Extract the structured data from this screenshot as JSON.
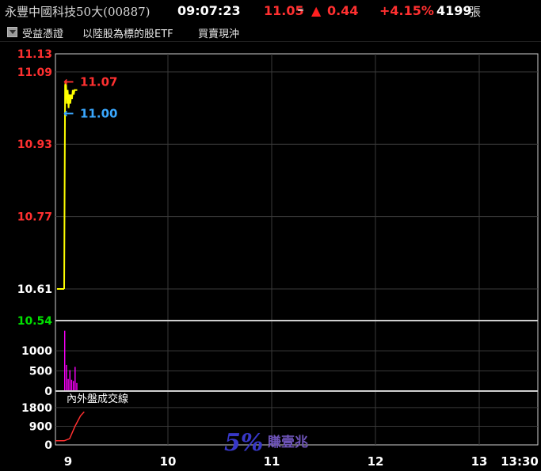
{
  "header": {
    "name": "永豐中國科技50大(00887)",
    "time": "09:07:23",
    "price": "11.05",
    "eq": "=",
    "change": "0.44",
    "percent": "+4.15%",
    "volume": "4199",
    "volume_unit": "張"
  },
  "subbar": {
    "items": [
      "受益憑證",
      "以陸股為標的股ETF",
      "買賣現沖"
    ]
  },
  "colors": {
    "up": "#ff3030",
    "price_line": "#ffff00",
    "volume_bar": "#ff00ff",
    "grid": "#3a3a3a",
    "base_label": "#00e000",
    "low_marker": "#3aa8ff"
  },
  "chart_data": {
    "type": "line",
    "price_panel": {
      "y_ticks": [
        "11.13",
        "11.09",
        "10.93",
        "10.77",
        "10.61",
        "10.54"
      ],
      "ylim": [
        10.54,
        11.13
      ],
      "high_marker": "11.07",
      "low_marker": "11.00",
      "series": [
        {
          "x": [
            "09:00",
            "09:00",
            "09:01",
            "09:01",
            "09:02",
            "09:02",
            "09:03",
            "09:03",
            "09:04",
            "09:04",
            "09:05",
            "09:05",
            "09:06",
            "09:07"
          ],
          "values": [
            10.61,
            11.06,
            11.07,
            11.02,
            11.05,
            11.01,
            11.04,
            11.02,
            11.04,
            11.03,
            11.05,
            11.04,
            11.05,
            11.05
          ]
        }
      ]
    },
    "volume_panel": {
      "y_ticks": [
        "1000",
        "500",
        "0"
      ],
      "ylim": [
        0,
        1750
      ],
      "bars": [
        {
          "x": "09:00",
          "value": 1500
        },
        {
          "x": "09:01",
          "value": 650
        },
        {
          "x": "09:02",
          "value": 300
        },
        {
          "x": "09:03",
          "value": 520
        },
        {
          "x": "09:04",
          "value": 280
        },
        {
          "x": "09:05",
          "value": 250
        },
        {
          "x": "09:06",
          "value": 600
        },
        {
          "x": "09:07",
          "value": 200
        }
      ]
    },
    "flow_panel": {
      "label": "內外盤成交線",
      "y_ticks": [
        "1800",
        "900",
        "0"
      ],
      "ylim": [
        0,
        2600
      ],
      "series": [
        {
          "x": [
            "09:00",
            "09:02",
            "09:04",
            "09:06",
            "09:07"
          ],
          "values": [
            200,
            300,
            900,
            1400,
            1600
          ]
        }
      ]
    },
    "x_ticks": [
      "9",
      "10",
      "11",
      "12",
      "13",
      "13:30"
    ],
    "watermark": {
      "big": "5%",
      "small": "賺壹兆"
    }
  }
}
